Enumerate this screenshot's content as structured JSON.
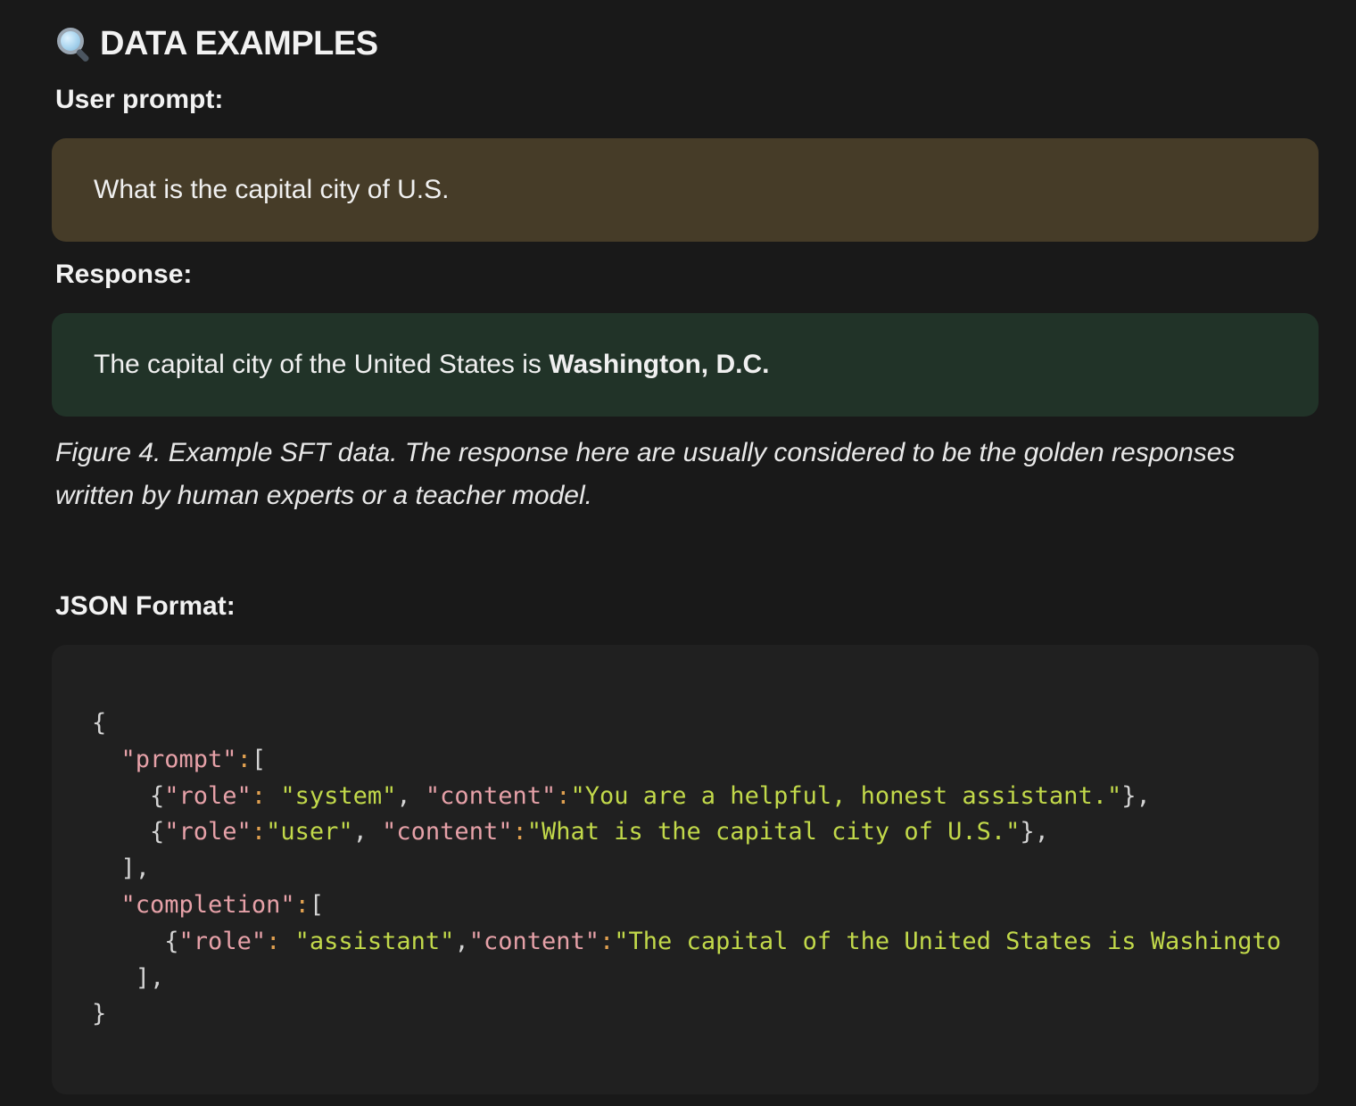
{
  "heading": {
    "icon": "magnifying-glass-icon",
    "title": "DATA EXAMPLES"
  },
  "user_prompt": {
    "label": "User prompt:",
    "text": "What is the capital city of U.S.",
    "bg_color": "#463c28"
  },
  "response": {
    "label": "Response:",
    "text_before": "The capital city of the United States is ",
    "text_bold": "Washington, D.C.",
    "bg_color": "#213328"
  },
  "caption": "Figure 4. Example SFT data. The response here are usually considered to be the golden responses written by human experts or a teacher model.",
  "json_format": {
    "label": "JSON Format:",
    "lines": [
      "{",
      "  \"prompt\":[",
      "    {\"role\": \"system\", \"content\":\"You are a helpful, honest assistant.\"},",
      "    {\"role\":\"user\", \"content\":\"What is the capital city of U.S.\"},",
      "  ],",
      "  \"completion\":[",
      "     {\"role\": \"assistant\",\"content\":\"The capital of the United States is Washington, D.C.\"}",
      "   ],",
      "}"
    ],
    "colors": {
      "key": "#e6a1a8",
      "string": "#c2d94a",
      "punctuation": "#d4d4d4",
      "colon": "#e0a050"
    }
  }
}
